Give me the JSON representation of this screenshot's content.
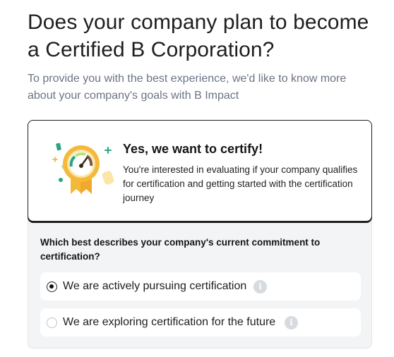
{
  "heading": "Does your company plan to become a Certified B Corporation?",
  "subheading": "To provide you with the best experience, we'd like to know more about your company's goals with B Impact",
  "certify_card": {
    "title": "Yes, we want to certify!",
    "description": "You're interested in evaluating if your company qualifies for certification and getting started with the certification journey",
    "badge_icon": "certification-badge-gauge-icon"
  },
  "commitment": {
    "question": "Which best describes your company's current commitment to certification?",
    "options": [
      {
        "label": "We are actively pursuing certification",
        "selected": true,
        "info_icon": "info-icon"
      },
      {
        "label": "We are exploring certification for the future",
        "selected": false,
        "info_icon": "info-icon"
      }
    ]
  },
  "colors": {
    "text_dark": "#1e1e1e",
    "text_muted": "#6b7384",
    "panel_bg": "#f3f4f6",
    "badge_gold": "#f5b93a",
    "badge_cream": "#fbe6a8",
    "badge_teal": "#2aa384",
    "badge_green": "#b7e27a"
  }
}
